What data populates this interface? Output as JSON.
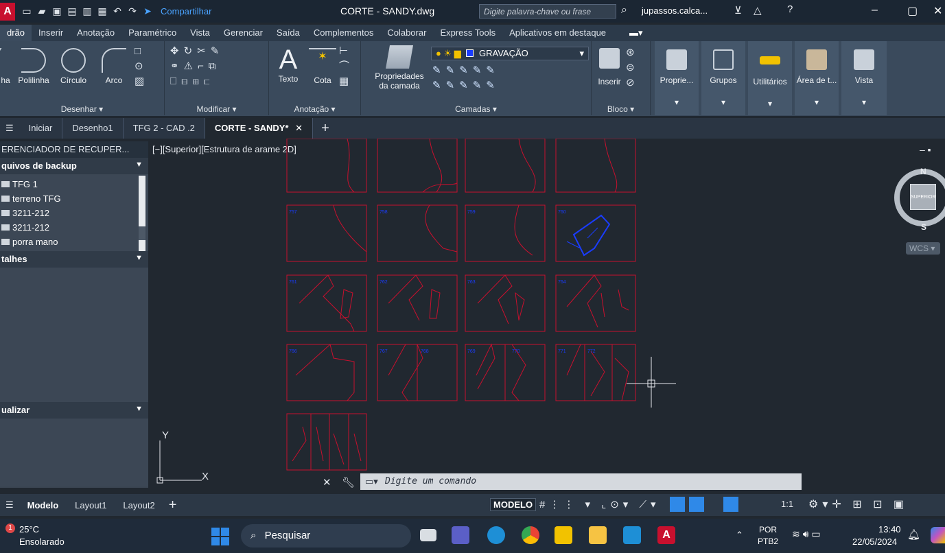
{
  "titlebar": {
    "app_logo": "A",
    "share_label": "Compartilhar",
    "doc_title": "CORTE - SANDY.dwg",
    "search_placeholder": "Digite palavra-chave ou frase",
    "user": "jupassos.calca..."
  },
  "ribbon_tabs": [
    "drão",
    "Inserir",
    "Anotação",
    "Paramétrico",
    "Vista",
    "Gerenciar",
    "Saída",
    "Complementos",
    "Colaborar",
    "Express Tools",
    "Aplicativos em destaque"
  ],
  "ribbon": {
    "desenhar": {
      "items": [
        "ha",
        "Polilinha",
        "Círculo",
        "Arco"
      ],
      "label": "Desenhar ▾"
    },
    "modificar": {
      "label": "Modificar ▾"
    },
    "anotacao": {
      "items": [
        "Texto",
        "Cota"
      ],
      "label": "Anotação ▾"
    },
    "camadas": {
      "props": "Propriedades\nda camada",
      "layer": "GRAVAÇÃO",
      "label": "Camadas ▾"
    },
    "bloco": {
      "item": "Inserir",
      "label": "Bloco ▾"
    },
    "right_groups": [
      "Proprie...",
      "Grupos",
      "Utilitários",
      "Área de t...",
      "Vista"
    ]
  },
  "doc_tabs": [
    "Iniciar",
    "Desenho1",
    "TFG 2 - CAD .2",
    "CORTE - SANDY*"
  ],
  "palette": {
    "title": "ERENCIADOR DE RECUPER...",
    "backup_header": "quivos de backup",
    "backup_items": [
      "TFG 1",
      "terreno TFG",
      "3211-212",
      "3211-212",
      "porra mano"
    ],
    "details_header": "talhes",
    "preview_header": "ualizar"
  },
  "viewport": {
    "label": "[−][Superior][Estrutura de arame 2D]",
    "viewcube_north": "N",
    "viewcube_south": "S",
    "viewcube_face": "SUPERIOR",
    "wcs": "WCS",
    "ucs_y": "Y",
    "ucs_x": "X"
  },
  "command": {
    "placeholder": "Digite um comando"
  },
  "layout_tabs": [
    "Modelo",
    "Layout1",
    "Layout2"
  ],
  "status": {
    "mode": "MODELO",
    "scale": "1:1"
  },
  "taskbar": {
    "weather_temp": "25°C",
    "weather_desc": "Ensolarado",
    "badge": "1",
    "search": "Pesquisar",
    "lang": "POR",
    "lang2": "PTB2",
    "time": "13:40",
    "date": "22/05/2024"
  },
  "colors": {
    "accent": "#2f89e8",
    "drawing_red": "#c8102e",
    "drawing_blue": "#1a3cff"
  }
}
